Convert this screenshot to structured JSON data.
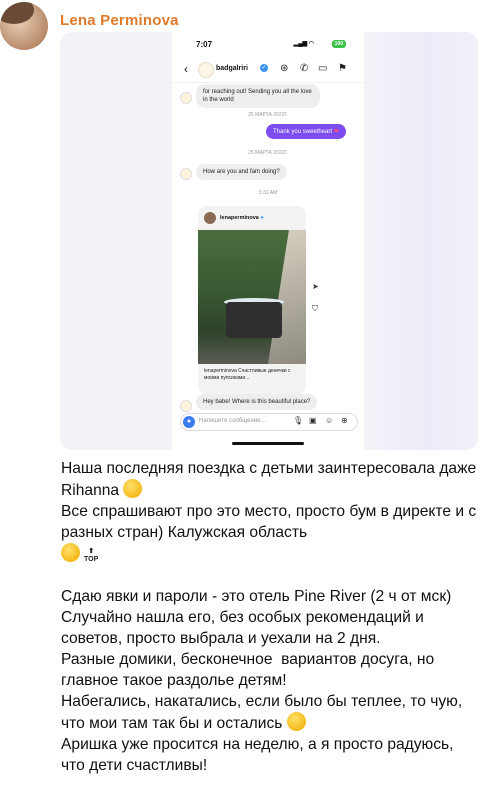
{
  "message": {
    "sender": "Lena Perminova",
    "paragraphs": [
      "Наша последняя поездка с детьми заинтересовала даже Rihanna",
      "Все спрашивают про это место, просто бум в директе и с разных стран) Калужская область",
      "Сдаю явки и пароли - это отель Pine River (2 ч от мск)",
      "Случайно нашла его, без особых рекомендаций и советов, просто выбрала и уехали на 2 дня.",
      "Разные домики, бесконечное  вариантов досуга, но главное такое раздолье детям!",
      "Набегались, накатались, если было бы теплее, то чую, что мои там так бы и остались",
      "Аришка уже просится на неделю, а я просто радуюсь, что дети счастливы!"
    ],
    "top_badge": "TOP"
  },
  "screenshot": {
    "status_time": "7:07",
    "battery": "100",
    "chat_user": "badgalriri",
    "messages": {
      "first_bubble": "for reaching out! Sending you all the love in the world",
      "date_1": "25 МАРТА 2022Г.",
      "reply": "Thank you sweetheart",
      "date_2": "25 МАРТА 2022Г.",
      "question": "How are you and fam doing?",
      "time": "5:31 AM",
      "last": "Hey babe! Where is this beautiful place?"
    },
    "post": {
      "username": "lenaperminova",
      "caption": "lenaperminova Счастливые денечки с моими пупсиками..."
    },
    "compose_placeholder": "Напишите сообщение…"
  }
}
